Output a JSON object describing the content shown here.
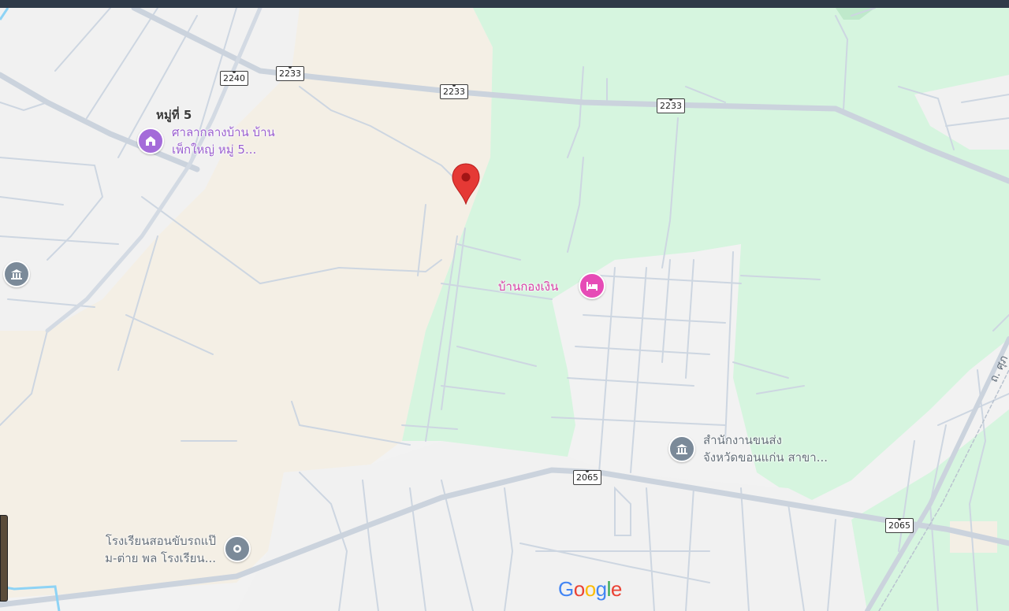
{
  "colors": {
    "background": "#f2f2f2",
    "forest": "#d6f5df",
    "farmland": "#f4efe5",
    "road": "#cfd8e3",
    "highway": "#d3dae3",
    "poi_gray": "#7b8a99",
    "poi_purple": "#a46bd9",
    "poi_pink": "#e64bb6",
    "pin_red": "#e53935"
  },
  "route_shields": [
    "2240",
    "2233",
    "2233",
    "2233",
    "2065",
    "2065"
  ],
  "area_label": "หมู่ที่ 5",
  "pois": [
    {
      "icon": "community-hall-icon",
      "line1": "ศาลากลางบ้าน บ้าน",
      "line2": "เพ็กใหญ่ หมู่ 5..."
    },
    {
      "icon": "hotel-icon",
      "line1": "บ้านกองเงิน"
    },
    {
      "icon": "government-building-icon",
      "line1": "สำนักงานขนส่ง",
      "line2": "จังหวัดขอนแก่น สาขา..."
    },
    {
      "icon": "place-icon",
      "line1": "โรงเรียนสอนขับรถแป๊",
      "line2": "ม-ต่าย พล โรงเรียน..."
    },
    {
      "icon": "government-building-icon"
    }
  ],
  "partial_street_label": "ถ. ศุภ",
  "logo": {
    "letters": [
      "G",
      "o",
      "o",
      "g",
      "l",
      "e"
    ],
    "colors": [
      "#4285F4",
      "#EA4335",
      "#FBBC05",
      "#4285F4",
      "#34A853",
      "#EA4335"
    ]
  },
  "marker": "location-pin-icon"
}
